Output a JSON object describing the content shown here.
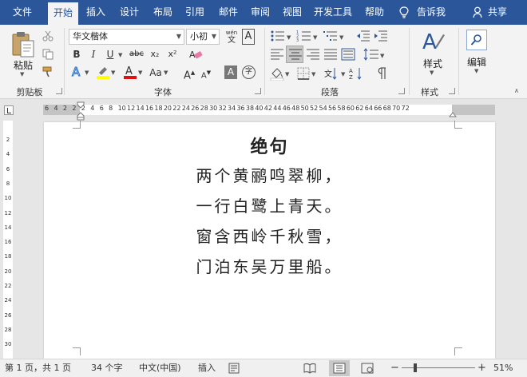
{
  "tabs": [
    {
      "label": "文件",
      "active": false
    },
    {
      "label": "开始",
      "active": true
    },
    {
      "label": "插入",
      "active": false
    },
    {
      "label": "设计",
      "active": false
    },
    {
      "label": "布局",
      "active": false
    },
    {
      "label": "引用",
      "active": false
    },
    {
      "label": "邮件",
      "active": false
    },
    {
      "label": "审阅",
      "active": false
    },
    {
      "label": "视图",
      "active": false
    },
    {
      "label": "开发工具",
      "active": false
    },
    {
      "label": "帮助",
      "active": false
    }
  ],
  "tell_me": "告诉我",
  "share": "共享",
  "ribbon": {
    "clipboard": {
      "paste_label": "粘贴",
      "group_label": "剪贴板"
    },
    "font": {
      "font_name": "华文楷体",
      "font_size": "小初",
      "wen_glyph": "wén",
      "bold": "B",
      "italic": "I",
      "underline": "U",
      "strike": "abc",
      "subscript": "x₂",
      "superscript": "x²",
      "grow": "A",
      "shrink": "A",
      "case": "Aa",
      "char_shade": "A",
      "enclose": "字",
      "boxed_a": "A",
      "group_label": "字体"
    },
    "paragraph": {
      "group_label": "段落"
    },
    "styles": {
      "label": "样式",
      "group_label": "样式"
    },
    "editing": {
      "label": "编辑"
    }
  },
  "ruler": {
    "numbers": [
      "6",
      "4",
      "2",
      "2",
      "2",
      "4",
      "6",
      "8",
      "10",
      "12",
      "14",
      "16",
      "18",
      "20",
      "22",
      "24",
      "26",
      "28",
      "30",
      "32",
      "34",
      "36",
      "38",
      "40",
      "42",
      "44",
      "46",
      "48",
      "50",
      "52",
      "54",
      "56",
      "58",
      "60",
      "62",
      "64",
      "66",
      "68",
      "70",
      "72"
    ],
    "vertical_numbers": [
      "2",
      "4",
      "6",
      "8",
      "10",
      "12",
      "14",
      "16",
      "18",
      "20",
      "22",
      "24",
      "26",
      "28",
      "30"
    ]
  },
  "document": {
    "title": "绝句",
    "lines": [
      "两个黄鹂鸣翠柳，",
      "一行白鹭上青天。",
      "窗含西岭千秋雪，",
      "门泊东吴万里船。"
    ]
  },
  "status": {
    "page": "第 1 页，共 1 页",
    "words": "34 个字",
    "language": "中文(中国)",
    "mode": "插入",
    "zoom": "51%",
    "zoom_minus": "−",
    "zoom_plus": "+"
  },
  "colors": {
    "accent": "#2b579a",
    "highlight": "#ffff00",
    "font_color": "#e01010"
  }
}
